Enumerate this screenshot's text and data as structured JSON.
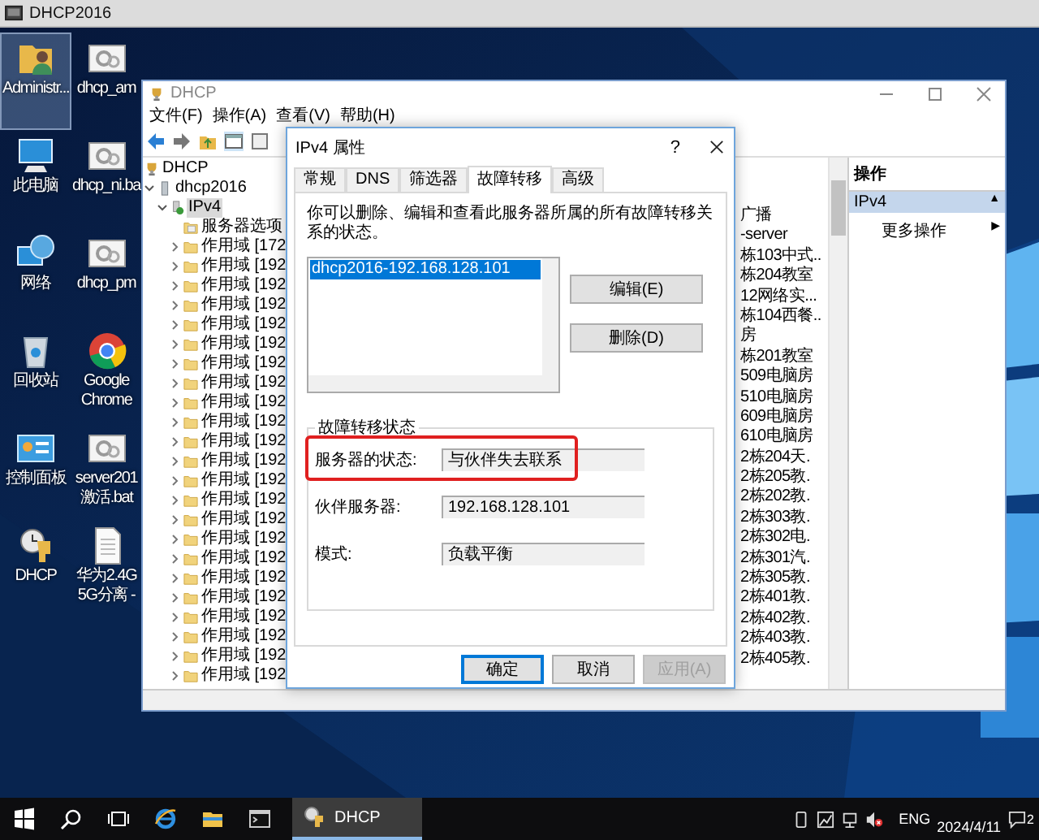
{
  "host_window": {
    "title": "DHCP2016"
  },
  "desktop_icons": [
    {
      "kind": "user-folder",
      "lines": [
        "Administr..."
      ],
      "selected": true
    },
    {
      "kind": "gear-file",
      "lines": [
        "dhcp_am"
      ],
      "selected": false
    },
    {
      "kind": "computer",
      "lines": [
        "此电脑"
      ],
      "selected": false
    },
    {
      "kind": "gear-file",
      "lines": [
        "dhcp_ni.ba"
      ],
      "selected": false
    },
    {
      "kind": "network",
      "lines": [
        "网络"
      ],
      "selected": false
    },
    {
      "kind": "gear-file",
      "lines": [
        "dhcp_pm"
      ],
      "selected": false
    },
    {
      "kind": "recycle-bin",
      "lines": [
        "回收站"
      ],
      "selected": false
    },
    {
      "kind": "browser",
      "lines": [
        "Google",
        "Chrome"
      ],
      "selected": false
    },
    {
      "kind": "control-panel",
      "lines": [
        "控制面板"
      ],
      "selected": false
    },
    {
      "kind": "gear-file",
      "lines": [
        "server201",
        "激活.bat"
      ],
      "selected": false
    },
    {
      "kind": "dhcp",
      "lines": [
        "DHCP"
      ],
      "selected": false
    },
    {
      "kind": "document",
      "lines": [
        "华为2.4G",
        "5G分离 -"
      ],
      "selected": false
    }
  ],
  "mmc": {
    "title": "DHCP",
    "menu": [
      "文件(F)",
      "操作(A)",
      "查看(V)",
      "帮助(H)"
    ],
    "tree": [
      {
        "kind": "dhcp",
        "label": "DHCP",
        "selected": false,
        "children": [
          {
            "kind": "server",
            "label": "dhcp2016",
            "expanded": true,
            "selected": false,
            "children": [
              {
                "kind": "ipv4",
                "label": "IPv4",
                "expanded": true,
                "selected": true,
                "children": [
                  {
                    "kind": "options",
                    "label": "服务器选项",
                    "selected": false
                  },
                  {
                    "kind": "scope",
                    "label": "作用域 [172",
                    "expanded": false,
                    "selected": false
                  },
                  {
                    "kind": "scope",
                    "label": "作用域 [192",
                    "expanded": false,
                    "selected": false
                  },
                  {
                    "kind": "scope",
                    "label": "作用域 [192",
                    "expanded": false,
                    "selected": false
                  },
                  {
                    "kind": "scope",
                    "label": "作用域 [192",
                    "expanded": false,
                    "selected": false
                  },
                  {
                    "kind": "scope",
                    "label": "作用域 [192",
                    "expanded": false,
                    "selected": false
                  },
                  {
                    "kind": "scope",
                    "label": "作用域 [192",
                    "expanded": false,
                    "selected": false
                  },
                  {
                    "kind": "scope",
                    "label": "作用域 [192",
                    "expanded": false,
                    "selected": false
                  },
                  {
                    "kind": "scope",
                    "label": "作用域 [192",
                    "expanded": false,
                    "selected": false
                  },
                  {
                    "kind": "scope",
                    "label": "作用域 [192",
                    "expanded": false,
                    "selected": false
                  },
                  {
                    "kind": "scope",
                    "label": "作用域 [192",
                    "expanded": false,
                    "selected": false
                  },
                  {
                    "kind": "scope",
                    "label": "作用域 [192",
                    "expanded": false,
                    "selected": false
                  },
                  {
                    "kind": "scope",
                    "label": "作用域 [192",
                    "expanded": false,
                    "selected": false
                  },
                  {
                    "kind": "scope",
                    "label": "作用域 [192",
                    "expanded": false,
                    "selected": false
                  },
                  {
                    "kind": "scope",
                    "label": "作用域 [192",
                    "expanded": false,
                    "selected": false
                  },
                  {
                    "kind": "scope",
                    "label": "作用域 [192",
                    "expanded": false,
                    "selected": false
                  },
                  {
                    "kind": "scope",
                    "label": "作用域 [192",
                    "expanded": false,
                    "selected": false
                  },
                  {
                    "kind": "scope",
                    "label": "作用域 [192",
                    "expanded": false,
                    "selected": false
                  },
                  {
                    "kind": "scope",
                    "label": "作用域 [192",
                    "expanded": false,
                    "selected": false
                  },
                  {
                    "kind": "scope",
                    "label": "作用域 [192",
                    "expanded": false,
                    "selected": false
                  },
                  {
                    "kind": "scope",
                    "label": "作用域 [192",
                    "expanded": false,
                    "selected": false
                  },
                  {
                    "kind": "scope",
                    "label": "作用域 [192",
                    "expanded": false,
                    "selected": false
                  },
                  {
                    "kind": "scope",
                    "label": "作用域 [192",
                    "expanded": false,
                    "selected": false
                  },
                  {
                    "kind": "scope",
                    "label": "作用域 [192",
                    "expanded": false,
                    "selected": false
                  }
                ]
              }
            ]
          }
        ]
      }
    ],
    "list_column": [
      "广播",
      "-server",
      "栋103中式..",
      "栋204教室",
      "12网络实...",
      "栋104西餐..",
      "房",
      "栋201教室",
      "509电脑房",
      "510电脑房",
      "609电脑房",
      "610电脑房",
      "2栋204天.",
      "2栋205教.",
      "2栋202教.",
      "2栋303教.",
      "2栋302电.",
      "2栋301汽.",
      "2栋305教.",
      "2栋401教.",
      "2栋402教.",
      "2栋403教.",
      "2栋405教."
    ],
    "actions": {
      "title": "操作",
      "section": "IPv4",
      "section_toggle": "▲",
      "items": [
        {
          "label": "更多操作",
          "arrow": "▶"
        }
      ]
    }
  },
  "dialog": {
    "title": "IPv4 属性",
    "help": "?",
    "tabs": [
      {
        "label": "常规",
        "selected": false
      },
      {
        "label": "DNS",
        "selected": false
      },
      {
        "label": "筛选器",
        "selected": false
      },
      {
        "label": "故障转移",
        "selected": true
      },
      {
        "label": "高级",
        "selected": false
      }
    ],
    "description": "你可以删除、编辑和查看此服务器所属的所有故障转移关系的状态。",
    "relationships": [
      {
        "label": "dhcp2016-192.168.128.101",
        "selected": true
      }
    ],
    "side_buttons": [
      "编辑(E)",
      "删除(D)"
    ],
    "status_group": {
      "title": "故障转移状态",
      "fields": [
        {
          "label": "服务器的状态:",
          "value": "与伙伴失去联系",
          "highlighted": true
        },
        {
          "label": "伙伴服务器:",
          "value": "192.168.128.101",
          "highlighted": false
        },
        {
          "label": "模式:",
          "value": "负载平衡",
          "highlighted": false
        }
      ]
    },
    "buttons": [
      {
        "label": "确定",
        "default": true,
        "disabled": false
      },
      {
        "label": "取消",
        "default": false,
        "disabled": false
      },
      {
        "label": "应用(A)",
        "default": false,
        "disabled": true
      }
    ]
  },
  "taskbar": {
    "apps": [
      {
        "label": "DHCP",
        "active": true
      }
    ],
    "tray": {
      "language": "ENG",
      "date": "2024/4/11",
      "notifications": "2"
    }
  }
}
